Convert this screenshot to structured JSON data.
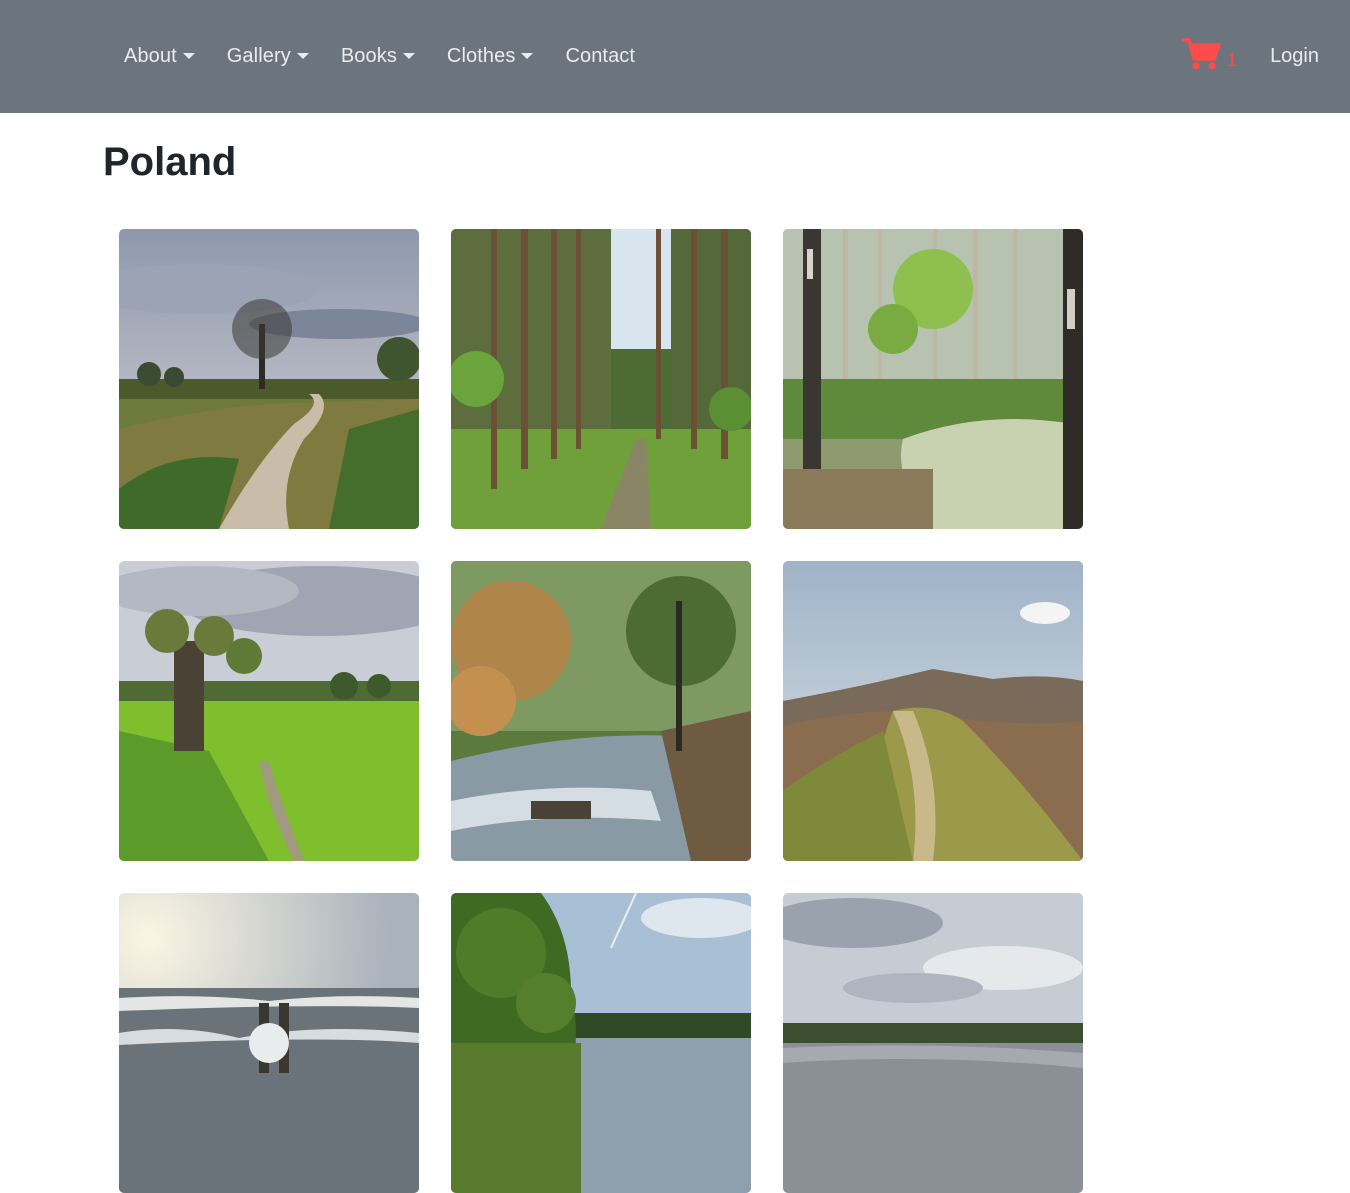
{
  "nav": {
    "items": [
      {
        "label": "About",
        "dropdown": true
      },
      {
        "label": "Gallery",
        "dropdown": true
      },
      {
        "label": "Books",
        "dropdown": true
      },
      {
        "label": "Clothes",
        "dropdown": true
      },
      {
        "label": "Contact",
        "dropdown": false
      }
    ],
    "cart": {
      "icon": "shopping-cart-icon",
      "count": "1",
      "color": "#ff4b4b"
    },
    "login_label": "Login",
    "background": "#6c757d"
  },
  "page": {
    "title": "Poland"
  },
  "gallery": {
    "photos": [
      {
        "subject": "country dirt road with lone tree"
      },
      {
        "subject": "pine forest path"
      },
      {
        "subject": "birch forest swamp"
      },
      {
        "subject": "pollard willow by green field"
      },
      {
        "subject": "forest stream with autumn leaves"
      },
      {
        "subject": "mountain ridge trail"
      },
      {
        "subject": "sea waves and wooden breakwater"
      },
      {
        "subject": "lake with forested shore"
      },
      {
        "subject": "wide river under cloudy sky"
      }
    ]
  }
}
